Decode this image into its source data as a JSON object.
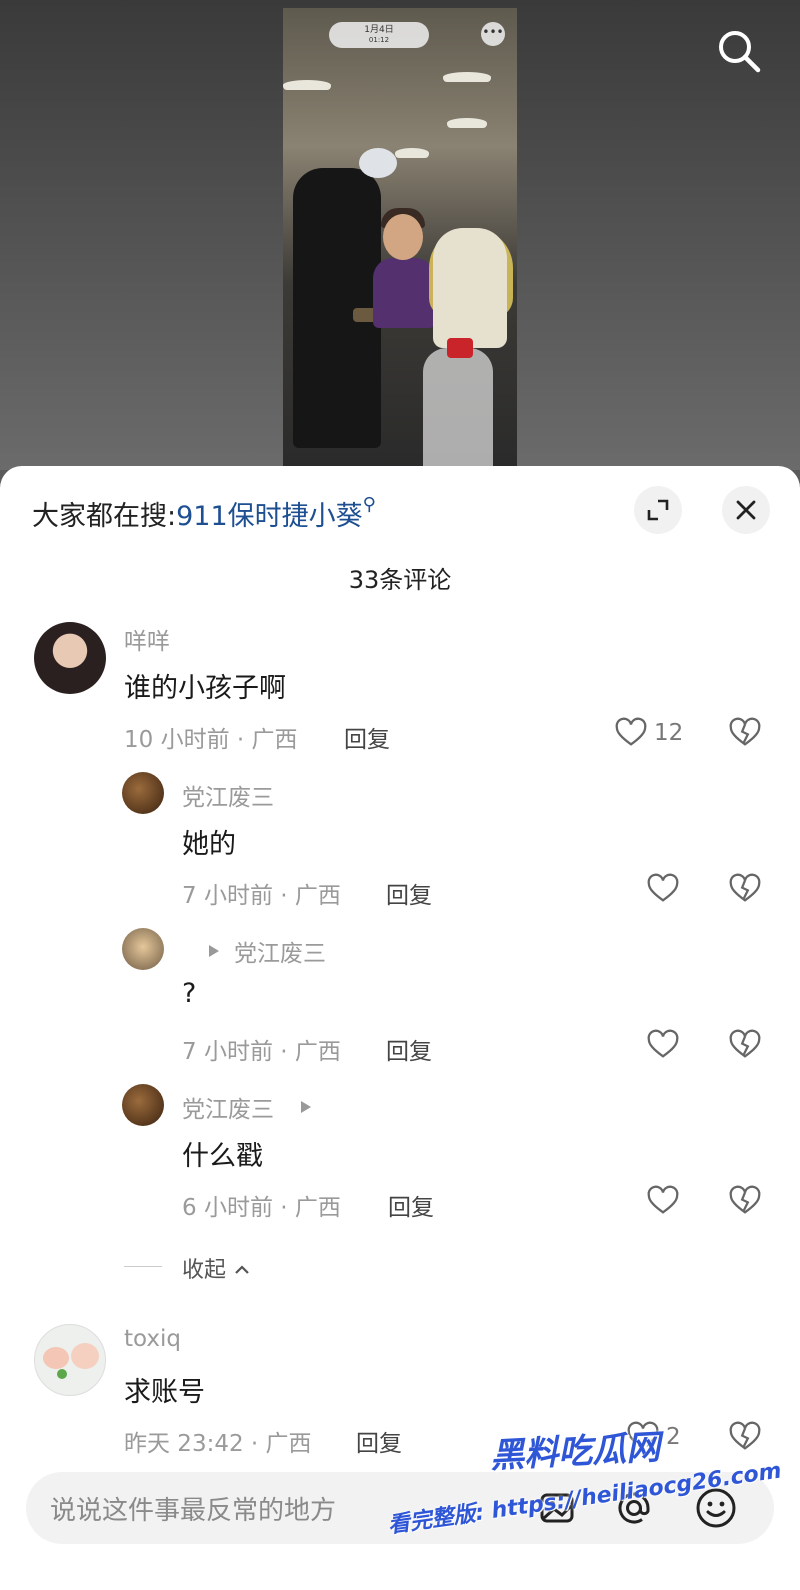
{
  "video": {
    "date_label": "1月4日",
    "time_label": "01:12",
    "more_icon": "ellipsis-icon"
  },
  "header": {
    "trend_prefix": "大家都在搜:",
    "trend_query": "911保时捷小葵",
    "expand_icon": "expand-icon",
    "close_icon": "close-icon",
    "comment_count": "33条评论"
  },
  "comments": [
    {
      "name": "咩咩",
      "text": "谁的小孩子啊",
      "meta": "10 小时前 · 广西",
      "reply": "回复",
      "likes": "12"
    },
    {
      "name": "党江废三",
      "text": "她的",
      "meta": "7 小时前 · 广西",
      "reply": "回复",
      "likes": ""
    },
    {
      "name": "",
      "reply_to": "党江废三",
      "text": "?",
      "meta": "7 小时前 · 广西",
      "reply": "回复",
      "likes": ""
    },
    {
      "name": "党江废三",
      "text": "什么戳",
      "meta": "6 小时前 · 广西",
      "reply": "回复",
      "likes": ""
    },
    {
      "name": "toxiq",
      "text": "求账号",
      "meta": "昨天 23:42 · 广西",
      "reply": "回复",
      "likes": "2"
    }
  ],
  "collapse_label": "收起",
  "input": {
    "placeholder": "说说这件事最反常的地方",
    "icons": [
      "image-icon",
      "at-icon",
      "emoji-icon"
    ]
  },
  "watermark": {
    "title": "黑料吃瓜网",
    "subtitle": "看完整版: https://heiliaocg26.com"
  },
  "colors": {
    "link": "#1d4f91",
    "sheet": "#ffffff",
    "watermark": "#2f56d6"
  }
}
